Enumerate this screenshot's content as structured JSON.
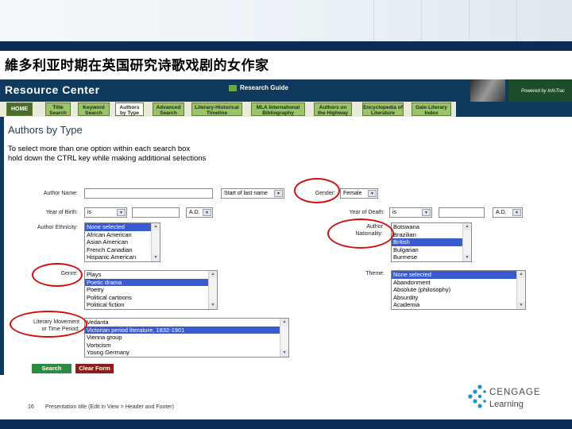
{
  "slide": {
    "title": "維多利亚时期在英国研究诗歌戏剧的女作家",
    "page_number": "16",
    "footer_text": "Presentation title (Edit in View > Header and Footer)",
    "logo_name": "CENGAGE",
    "logo_sub": "Learning"
  },
  "app": {
    "brand": "Resource Center",
    "research_guide": "Research Guide",
    "powered_by": "Powered by InfoTrac"
  },
  "nav": [
    {
      "label": "HOME"
    },
    {
      "label": "Title Search"
    },
    {
      "label": "Keyword Search"
    },
    {
      "label": "Authors by Type"
    },
    {
      "label": "Advanced Search"
    },
    {
      "label": "Literary-Historical Timeline"
    },
    {
      "label": "MLA International Bibliography"
    },
    {
      "label": "Authors on the Highway"
    },
    {
      "label": "Encyclopedia of Literature"
    },
    {
      "label": "Gale Literary Index"
    }
  ],
  "page": {
    "heading": "Authors by Type",
    "instruction_line1": "To select more than one option within each search box",
    "instruction_line2": "hold down the CTRL key while making additional selections"
  },
  "form": {
    "author_name_label": "Author Name:",
    "author_name_value": "",
    "name_mode": "Start of last name",
    "gender_label": "Gender:",
    "gender_value": "Female",
    "birth_label": "Year of Birth:",
    "birth_op": "is",
    "birth_year": "",
    "birth_era": "A.D.",
    "death_label": "Year of Death:",
    "death_op": "is",
    "death_year": "",
    "death_era": "A.D.",
    "ethnicity_label": "Author Ethnicity:",
    "ethnicity_options": [
      "None selected",
      "African American",
      "Asian American",
      "French Canadian",
      "Hispanic American"
    ],
    "nationality_label_1": "Author",
    "nationality_label_2": "Nationality:",
    "nationality_options": [
      "Botswana",
      "Brazilian",
      "British",
      "Bulgarian",
      "Burmese"
    ],
    "genre_label": "Genre:",
    "genre_options": [
      "Plays",
      "Poetic drama",
      "Poetry",
      "Political cartoons",
      "Political fiction"
    ],
    "theme_label": "Theme:",
    "theme_options": [
      "None selected",
      "Abandonment",
      "Absolute (philosophy)",
      "Absurdity",
      "Academia"
    ],
    "movement_label_1": "Literary Movement",
    "movement_label_2": "or Time Period:",
    "movement_options": [
      "Vedanta",
      "Victorian period literature, 1832-1901",
      "Vienna group",
      "Vorticism",
      "Young Germany"
    ],
    "search_label": "Search",
    "clear_label": "Clear Form"
  }
}
